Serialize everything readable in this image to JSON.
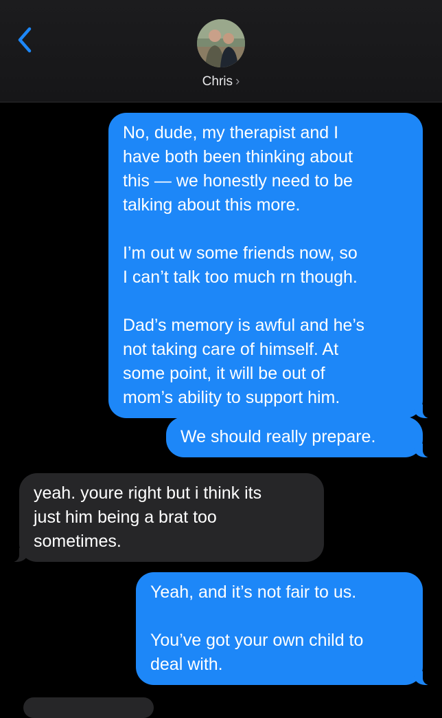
{
  "header": {
    "contact_name": "Chris",
    "chevron": "›",
    "back_icon": "chevron-left-icon",
    "accent_color": "#1d87f8"
  },
  "messages": [
    {
      "direction": "outgoing",
      "text": "No, dude, my therapist and I\nhave both been thinking about\nthis — we honestly need to be\ntalking about this more.\n\nI’m out w some friends now, so\nI can’t talk too much rn though.\n\nDad’s memory is awful and he’s\nnot taking care of himself. At\nsome point, it will be out of\nmom’s ability to support him."
    },
    {
      "direction": "outgoing",
      "text": "We should really prepare."
    },
    {
      "direction": "incoming",
      "text": "yeah. youre right but i think its\njust him being a brat too\nsometimes."
    },
    {
      "direction": "outgoing",
      "text": "Yeah, and it’s not fair to us.\n\nYou’ve got your own child to\ndeal with."
    }
  ],
  "colors": {
    "outgoing_bubble": "#1d87f8",
    "incoming_bubble": "#262628",
    "background": "#000000"
  }
}
